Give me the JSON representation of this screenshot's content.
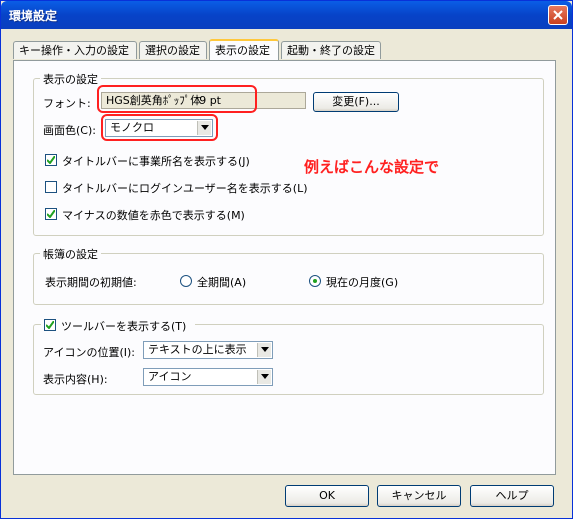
{
  "window": {
    "title": "環境設定",
    "close_label": "×"
  },
  "tabs": [
    {
      "label": "キー操作・入力の設定"
    },
    {
      "label": "選択の設定"
    },
    {
      "label": "表示の設定"
    },
    {
      "label": "起動・終了の設定"
    }
  ],
  "display_group": {
    "label": "表示の設定",
    "font_label": "フォント:",
    "font_value": "HGS創英角ﾎﾟｯﾌﾟ体",
    "font_size": "9 pt",
    "change_button": "変更(F)...",
    "screen_color_label": "画面色(C):",
    "screen_color_value": "モノクロ",
    "checks": [
      {
        "label": "タイトルバーに事業所名を表示する(J)",
        "checked": true
      },
      {
        "label": "タイトルバーにログインユーザー名を表示する(L)",
        "checked": false
      },
      {
        "label": "マイナスの数値を赤色で表示する(M)",
        "checked": true
      }
    ]
  },
  "annotation": "例えばこんな設定で",
  "ledger_group": {
    "label": "帳簿の設定",
    "period_label": "表示期間の初期値:",
    "radios": [
      {
        "label": "全期間(A)",
        "selected": false
      },
      {
        "label": "現在の月度(G)",
        "selected": true
      }
    ]
  },
  "toolbar_group": {
    "label": "ツールバーを表示する(T)",
    "checked": true,
    "icon_pos_label": "アイコンの位置(I):",
    "icon_pos_value": "テキストの上に表示",
    "content_label": "表示内容(H):",
    "content_value": "アイコン"
  },
  "footer": {
    "ok": "OK",
    "cancel": "キャンセル",
    "help": "ヘルプ"
  },
  "colors": {
    "title_bar": "#0743c8",
    "annotation": "#ff2020",
    "dialog_bg": "#ece9d8"
  }
}
